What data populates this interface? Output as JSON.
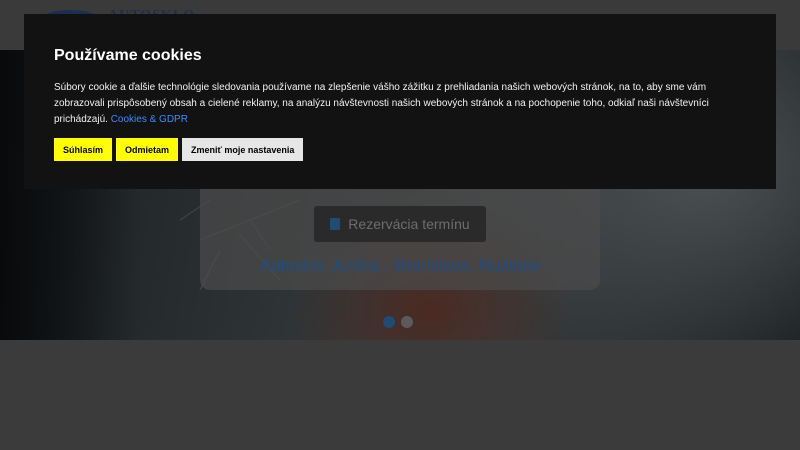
{
  "header": {
    "logo_text": "AUTOSKLO"
  },
  "hero": {
    "reserve_button": "Rezervácia termínu",
    "title": "Autosklo Jurišta - Bratislava, Ružinov",
    "slide_count": 2,
    "active_slide": 1
  },
  "cookie": {
    "title": "Používame cookies",
    "text": "Súbory cookie a ďalšie technológie sledovania používame na zlepšenie vášho zážitku z prehliadania našich webových stránok, na to, aby sme vám zobrazovali prispôsobený obsah a cielené reklamy, na analýzu návštevnosti našich webových stránok a na pochopenie toho, odkiaľ naši návštevníci prichádzajú.",
    "link": "Cookies & GDPR",
    "accept_button": "Súhlasím",
    "reject_button": "Odmietam",
    "settings_button": "Zmeniť moje nastavenia"
  },
  "colors": {
    "banner_bg": "#121212",
    "accept_bg": "#ffff00",
    "link": "#3d8bfd",
    "brand_blue": "#1f4e82"
  },
  "icons": {
    "reserve": "calendar-icon"
  }
}
